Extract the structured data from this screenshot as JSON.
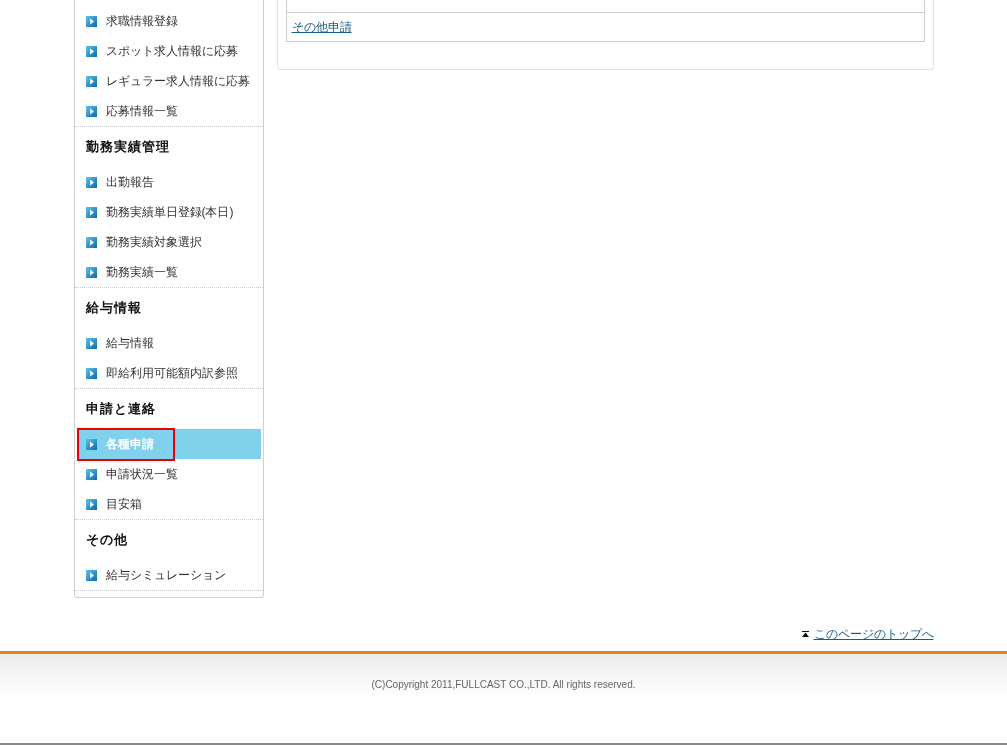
{
  "sidebar": {
    "sections": [
      {
        "items": [
          {
            "label": "求職情報登録",
            "selected": false,
            "highlighted": false
          },
          {
            "label": "スポット求人情報に応募",
            "selected": false,
            "highlighted": false
          },
          {
            "label": "レギュラー求人情報に応募",
            "selected": false,
            "highlighted": false
          },
          {
            "label": "応募情報一覧",
            "selected": false,
            "highlighted": false
          }
        ]
      },
      {
        "heading": "勤務実績管理",
        "items": [
          {
            "label": "出勤報告",
            "selected": false,
            "highlighted": false
          },
          {
            "label": "勤務実績単日登録(本日)",
            "selected": false,
            "highlighted": false
          },
          {
            "label": "勤務実績対象選択",
            "selected": false,
            "highlighted": false
          },
          {
            "label": "勤務実績一覧",
            "selected": false,
            "highlighted": false
          }
        ]
      },
      {
        "heading": "給与情報",
        "items": [
          {
            "label": "給与情報",
            "selected": false,
            "highlighted": false
          },
          {
            "label": "即給利用可能額内訳参照",
            "selected": false,
            "highlighted": false
          }
        ]
      },
      {
        "heading": "申請と連絡",
        "items": [
          {
            "label": "各種申請",
            "selected": true,
            "highlighted": true
          },
          {
            "label": "申請状況一覧",
            "selected": false,
            "highlighted": false
          },
          {
            "label": "目安箱",
            "selected": false,
            "highlighted": false
          }
        ]
      },
      {
        "heading": "その他",
        "items": [
          {
            "label": "給与シミュレーション",
            "selected": false,
            "highlighted": false
          }
        ]
      }
    ]
  },
  "content": {
    "links": [
      {
        "label": "その他申請"
      }
    ]
  },
  "back_to_top": {
    "label": "このページのトップへ"
  },
  "footer": {
    "copyright": "(C)Copyright 2011,FULLCAST CO.,LTD. All rights reserved."
  }
}
